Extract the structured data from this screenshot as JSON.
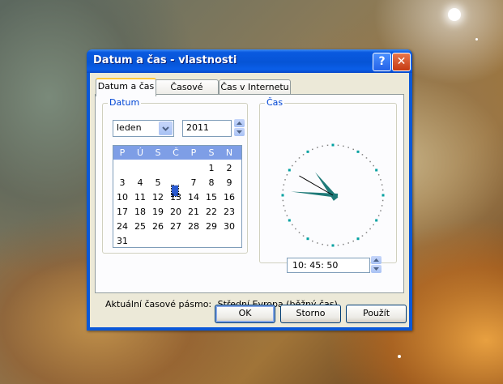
{
  "window": {
    "title": "Datum a čas - vlastnosti",
    "help_glyph": "?",
    "close_glyph": "✕"
  },
  "tabs": [
    {
      "label": "Datum a čas",
      "active": true
    },
    {
      "label": "Časové pásmo",
      "active": false
    },
    {
      "label": "Čas v Internetu",
      "active": false
    }
  ],
  "date_group": {
    "title": "Datum",
    "month": "leden",
    "year": "2011",
    "weekday_headers": [
      "P",
      "Ú",
      "S",
      "Č",
      "P",
      "S",
      "N"
    ],
    "days": [
      [
        "",
        "",
        "",
        "",
        "",
        "1",
        "2"
      ],
      [
        "3",
        "4",
        "5",
        "6",
        "7",
        "8",
        "9"
      ],
      [
        "10",
        "11",
        "12",
        "13",
        "14",
        "15",
        "16"
      ],
      [
        "17",
        "18",
        "19",
        "20",
        "21",
        "22",
        "23"
      ],
      [
        "24",
        "25",
        "26",
        "27",
        "28",
        "29",
        "30"
      ],
      [
        "31",
        "",
        "",
        "",
        "",
        "",
        ""
      ]
    ],
    "selected_day": "6"
  },
  "time_group": {
    "title": "Čas",
    "time": "10: 45: 50",
    "hours": 10,
    "minutes": 45,
    "seconds": 50
  },
  "timezone": {
    "label": "Aktuální časové pásmo:",
    "value": "Střední Evropa (běžný čas)"
  },
  "buttons": {
    "ok": "OK",
    "cancel": "Storno",
    "apply": "Použít"
  },
  "colors": {
    "title_bar": "#0a58d8",
    "calendar_header": "#7e9ee6",
    "clock_hand": "#1e7a78",
    "clock_dot": "#00a0a0"
  }
}
